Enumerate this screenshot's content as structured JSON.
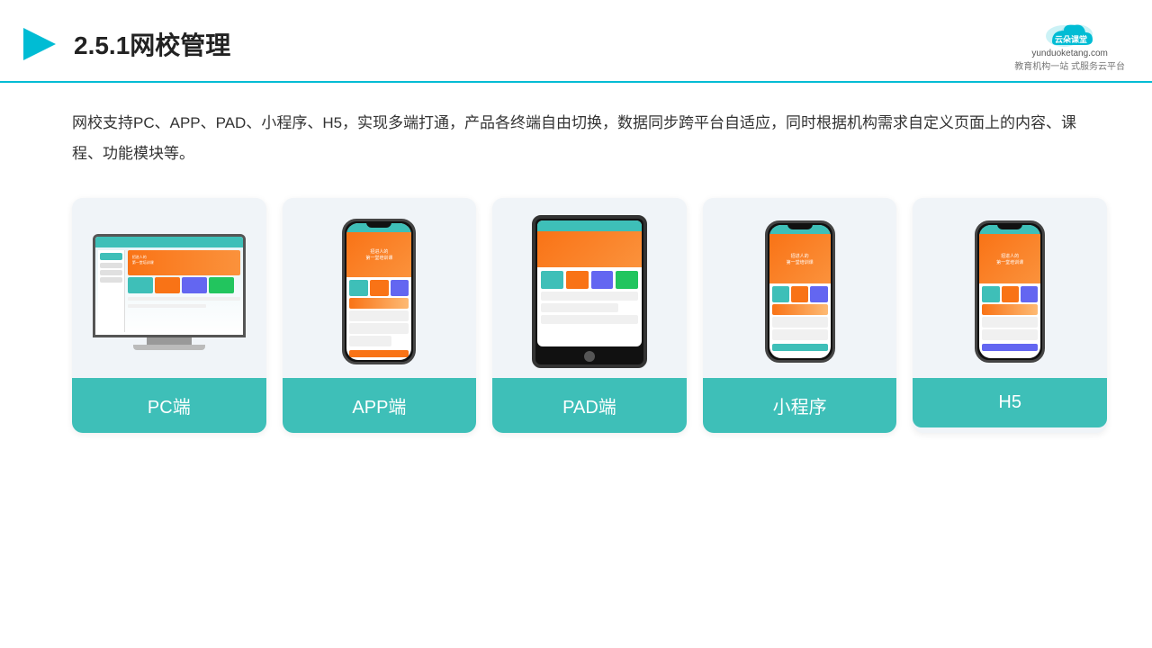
{
  "header": {
    "title": "2.5.1网校管理",
    "brand_name": "云朵课堂",
    "brand_url": "yunduoketang.com",
    "brand_tagline": "教育机构一站",
    "brand_sub": "式服务云平台"
  },
  "description": "网校支持PC、APP、PAD、小程序、H5，实现多端打通，产品各终端自由切换，数据同步跨平台自适应，同时根据机构需求自定义页面上的内容、课程、功能模块等。",
  "cards": [
    {
      "id": "pc",
      "label": "PC端"
    },
    {
      "id": "app",
      "label": "APP端"
    },
    {
      "id": "pad",
      "label": "PAD端"
    },
    {
      "id": "miniprogram",
      "label": "小程序"
    },
    {
      "id": "h5",
      "label": "H5"
    }
  ]
}
